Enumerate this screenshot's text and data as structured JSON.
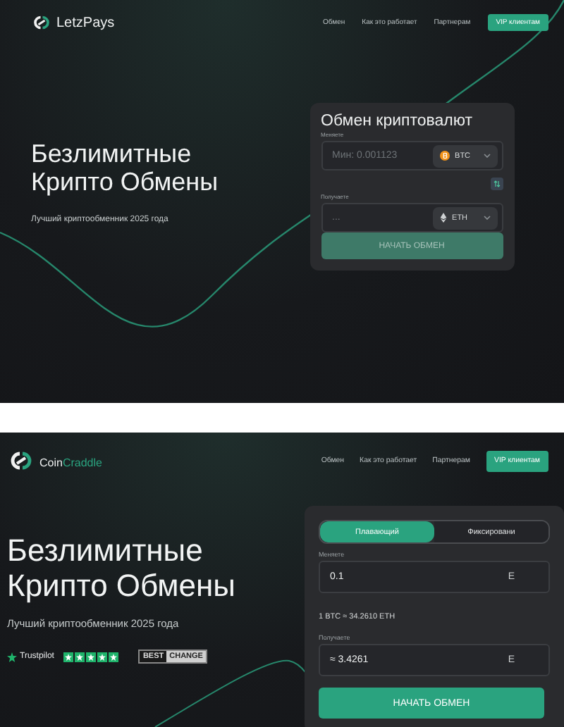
{
  "top_site": {
    "logo": "LetzPays",
    "nav": [
      {
        "label": "Обмен"
      },
      {
        "label": "Как это работает"
      },
      {
        "label": "Партнерам"
      }
    ],
    "cta": "VIP клиентам",
    "title_lines": [
      "Безлимитные",
      "Крипто Обмены"
    ],
    "subtitle": "Лучший криптообменник 2025 года",
    "card": {
      "title": "Обмен криптовалют",
      "send_label": "Меняете",
      "send_placeholder": "Мин: 0.001123",
      "send_currency": "BTC",
      "receive_label": "Получаете",
      "receive_placeholder": "...",
      "receive_currency": "ETH",
      "button": "НАЧАТЬ ОБМЕН",
      "button_disabled": true
    }
  },
  "bottom_site": {
    "logo_parts": [
      "Coin",
      "Craddle"
    ],
    "nav": [
      {
        "label": "Обмен"
      },
      {
        "label": "Как это работает"
      },
      {
        "label": "Партнерам"
      }
    ],
    "cta": "VIP клиентам",
    "title_lines": [
      "Безлимитные",
      "Крипто Обмены"
    ],
    "subtitle": "Лучший криптообменник 2025 года",
    "trustpilot": {
      "label": "Trustpilot",
      "stars": 5
    },
    "bestchange": [
      "BEST",
      "CHANGE"
    ],
    "card": {
      "tabs": [
        {
          "label": "Плавающий",
          "selected": true
        },
        {
          "label": "Фиксировани",
          "selected": false
        }
      ],
      "send_label": "Меняете",
      "send_value": "0.1",
      "send_currency": "E",
      "rate": "1 BTC ≈ 34.2610 ETH",
      "receive_label": "Получаете",
      "receive_value": "≈ 3.4261",
      "receive_currency": "E",
      "button": "НАЧАТЬ ОБМЕН",
      "button_disabled": false
    }
  }
}
